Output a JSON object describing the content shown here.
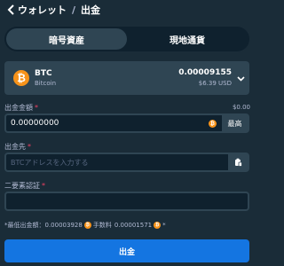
{
  "header": {
    "wallet_label": "ウォレット",
    "separator": "/",
    "page_label": "出金"
  },
  "tabs": [
    {
      "label": "暗号資産",
      "active": true
    },
    {
      "label": "現地通貨",
      "active": false
    }
  ],
  "currency": {
    "symbol": "BTC",
    "name": "Bitcoin",
    "balance": "0.00009155",
    "usd_value": "$6.39 USD",
    "coin_glyph": "₿"
  },
  "amount": {
    "label": "出金金額",
    "required_mark": "*",
    "usd_display": "$0.00",
    "value": "0.00000000",
    "max_label": "最高"
  },
  "address": {
    "label": "出金先",
    "required_mark": "*",
    "placeholder": "BTCアドレスを入力する"
  },
  "two_factor": {
    "label": "二要素認証",
    "required_mark": "*"
  },
  "info": {
    "prefix": "*最低出金額：",
    "min_amount": "0.00003928",
    "fee_label": "手数料",
    "fee_amount": "0.00001571",
    "suffix": "*"
  },
  "submit_label": "出金",
  "colors": {
    "background": "#1a2c38",
    "panel": "#2f4553",
    "input": "#0f212e",
    "accent": "#1475e1",
    "btc": "#f7931a",
    "required": "#ed4163"
  }
}
